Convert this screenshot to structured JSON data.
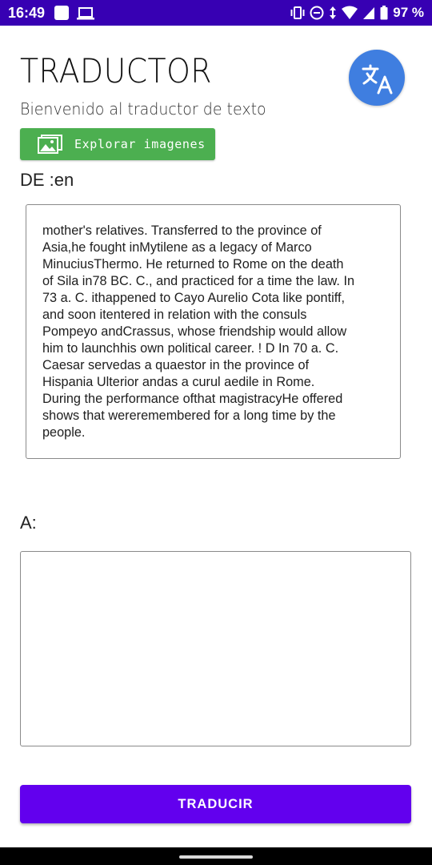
{
  "status_bar": {
    "time": "16:49",
    "battery_percent": "97 %",
    "icons": [
      "notification-square-icon",
      "laptop-icon",
      "vibrate-icon",
      "do-not-disturb-icon",
      "data-arrows-icon",
      "wifi-icon",
      "signal-icon",
      "battery-icon"
    ],
    "background_color": "#3700b3"
  },
  "header": {
    "title": "TRADUCTOR",
    "subtitle": "Bienvenido al traductor de texto",
    "translate_icon": "translate-icon",
    "translate_icon_color": "#3f7ee0"
  },
  "explore_button": {
    "label": "Explorar imagenes",
    "icon": "gallery-icon",
    "color": "#4caf50"
  },
  "source": {
    "lang_label": "DE :en",
    "text": "mother's relatives. Transferred to the province of\nAsia,he fought inMytilene as a legacy of Marco\nMinuciusThermo. He returned to Rome on the death\nof Sila in78 BC. C., and practiced for a time the law. In\n73 a. C. ithappened to Cayo Aurelio Cota like pontiff,\nand soon itentered in relation with the consuls\nPompeyo andCrassus, whose friendship would allow\nhim to launchhis own political career. ! D In 70 a. C.\nCaesar servedas a quaestor in the province of\nHispania Ulterior andas a curul aedile in Rome.\nDuring the performance ofthat magistracyHe offered\nshows that wereremembered for a long time by the\npeople."
  },
  "target": {
    "lang_label": "A:",
    "text": ""
  },
  "translate_button": {
    "label": "TRADUCIR",
    "color": "#6200ee"
  }
}
